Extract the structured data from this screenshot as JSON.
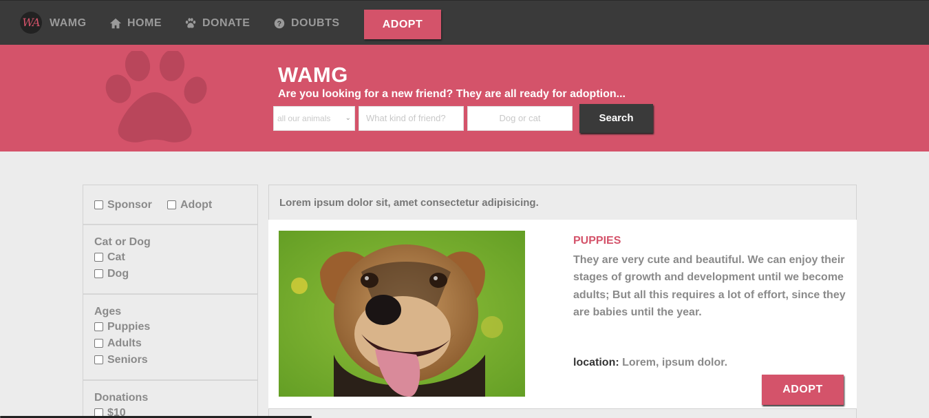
{
  "nav": {
    "logo": "WA",
    "brand": "WAMG",
    "home": "HOME",
    "donate": "DONATE",
    "doubts": "DOUBTS",
    "adopt": "ADOPT"
  },
  "hero": {
    "title": "WAMG",
    "subtitle": "Are you looking for a new friend? They are all ready for adoption...",
    "select_value": "all our animals",
    "kind_placeholder": "What kind of friend?",
    "type_placeholder": "Dog or cat",
    "search": "Search"
  },
  "sidebar": {
    "sponsor": "Sponsor",
    "adopt": "Adopt",
    "species_title": "Cat or Dog",
    "species": [
      "Cat",
      "Dog"
    ],
    "ages_title": "Ages",
    "ages": [
      "Puppies",
      "Adults",
      "Seniors"
    ],
    "donations_title": "Donations",
    "donations": [
      "$10"
    ]
  },
  "content": {
    "header": "Lorem ipsum dolor sit, amet consectetur adipisicing.",
    "card": {
      "title": "PUPPIES",
      "description": "They are very cute and beautiful. We can enjoy their stages of growth and development until we become adults; But all this requires a lot of effort, since they are babies until the year.",
      "location_label": "location:",
      "location_value": "Lorem, ipsum dolor.",
      "adopt": "ADOPT"
    }
  },
  "colors": {
    "accent": "#d4536a",
    "nav_bg": "#3a3a3a",
    "page_bg": "#ececec"
  }
}
